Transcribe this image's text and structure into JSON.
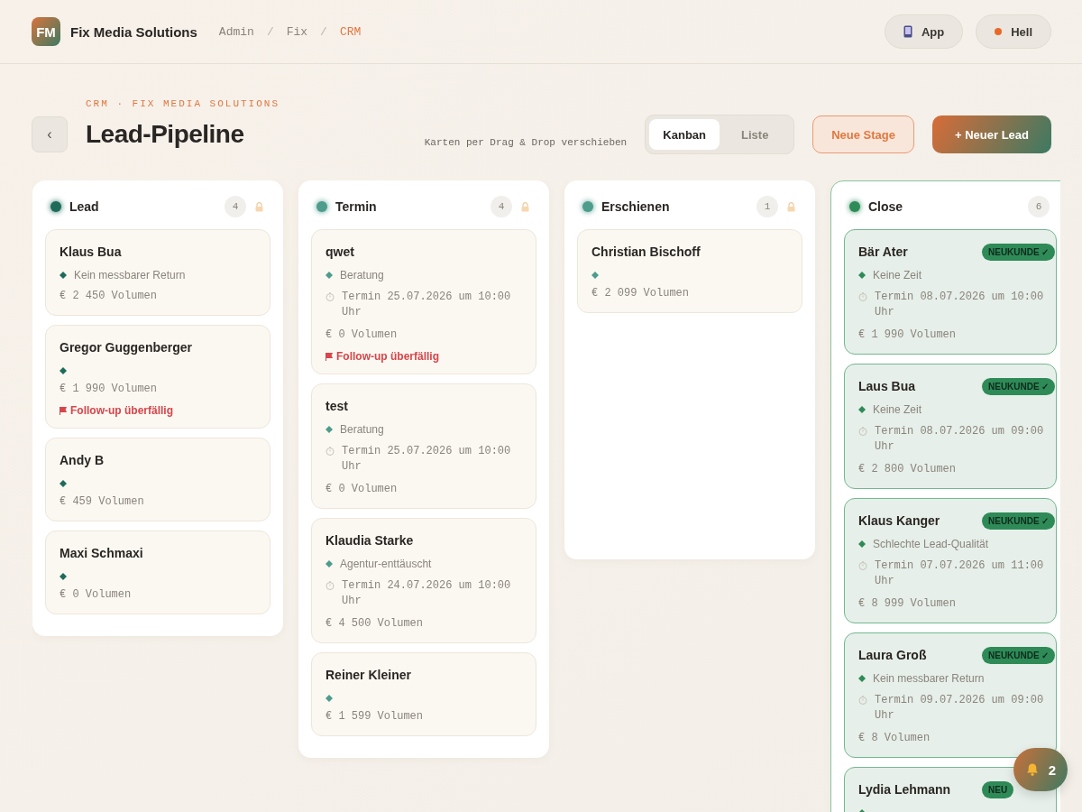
{
  "brand": {
    "logo": "FM",
    "name": "Fix Media Solutions"
  },
  "breadcrumbs": [
    {
      "label": "Admin",
      "selected": false
    },
    {
      "label": "Fix",
      "selected": false
    },
    {
      "label": "CRM",
      "selected": true
    }
  ],
  "breadcrumb_separator": "/",
  "header_buttons": [
    {
      "kind": "app",
      "label": "App"
    },
    {
      "kind": "theme",
      "label": "Hell"
    }
  ],
  "eyebrow": "CRM · FIX MEDIA SOLUTIONS",
  "back_button": "‹",
  "title": "Lead-Pipeline",
  "hint": "Karten per Drag & Drop verschieben",
  "view_tabs": [
    {
      "label": "Kanban",
      "selected": true
    },
    {
      "label": "Liste",
      "selected": false
    }
  ],
  "actions": [
    {
      "kind": "secondary",
      "label": "Neue Stage"
    },
    {
      "kind": "primary",
      "label": "+ Neuer Lead"
    }
  ],
  "columns": [
    {
      "name": "Lead",
      "count": "4",
      "color": "#1f6b5a",
      "locked": true,
      "kind": "open",
      "cards": [
        {
          "name": "Klaus Bua",
          "reason": "Kein messbarer Return",
          "volume": "€ 2 450 Volumen"
        },
        {
          "name": "Gregor Guggenberger",
          "volume": "€ 1 990 Volumen",
          "followup": "Follow-up überfällig"
        },
        {
          "name": "Andy B",
          "volume": "€ 459 Volumen"
        },
        {
          "name": "Maxi Schmaxi",
          "volume": "€ 0 Volumen"
        }
      ]
    },
    {
      "name": "Termin",
      "count": "4",
      "color": "#4d9c8c",
      "locked": true,
      "kind": "open",
      "cards": [
        {
          "name": "qwet",
          "reason": "Beratung",
          "appointment": "Termin 25.07.2026 um 10:00 Uhr",
          "volume": "€ 0 Volumen",
          "followup": "Follow-up überfällig"
        },
        {
          "name": "test",
          "reason": "Beratung",
          "appointment": "Termin 25.07.2026 um 10:00 Uhr",
          "volume": "€ 0 Volumen"
        },
        {
          "name": "Klaudia Starke",
          "reason": "Agentur-enttäuscht",
          "appointment": "Termin 24.07.2026 um 10:00 Uhr",
          "volume": "€ 4 500 Volumen"
        },
        {
          "name": "Reiner Kleiner",
          "volume": "€ 1 599 Volumen"
        }
      ]
    },
    {
      "name": "Erschienen",
      "count": "1",
      "color": "#4d9c8c",
      "locked": true,
      "kind": "open",
      "cards": [
        {
          "name": "Christian Bischoff",
          "volume": "€ 2 099 Volumen"
        }
      ]
    },
    {
      "name": "Close",
      "count": "6",
      "color": "#2e8b57",
      "locked": false,
      "kind": "won",
      "cards": [
        {
          "name": "Bär Ater",
          "badge": "NEUKUNDE ✓",
          "reason": "Keine Zeit",
          "appointment": "Termin 08.07.2026 um 10:00 Uhr",
          "volume": "€ 1 990 Volumen"
        },
        {
          "name": "Laus Bua",
          "badge": "NEUKUNDE ✓",
          "reason": "Keine Zeit",
          "appointment": "Termin 08.07.2026 um 09:00 Uhr",
          "volume": "€ 2 800 Volumen"
        },
        {
          "name": "Klaus Kanger",
          "badge": "NEUKUNDE ✓",
          "reason": "Schlechte Lead-Qualität",
          "appointment": "Termin 07.07.2026 um 11:00 Uhr",
          "volume": "€ 8 999 Volumen"
        },
        {
          "name": "Laura Groß",
          "badge": "NEUKUNDE ✓",
          "reason": "Kein messbarer Return",
          "appointment": "Termin 09.07.2026 um 09:00 Uhr",
          "volume": "€ 8 Volumen"
        },
        {
          "name": "Lydia Lehmann",
          "badge": "NEU"
        }
      ]
    }
  ],
  "notifications": {
    "count": "2"
  }
}
